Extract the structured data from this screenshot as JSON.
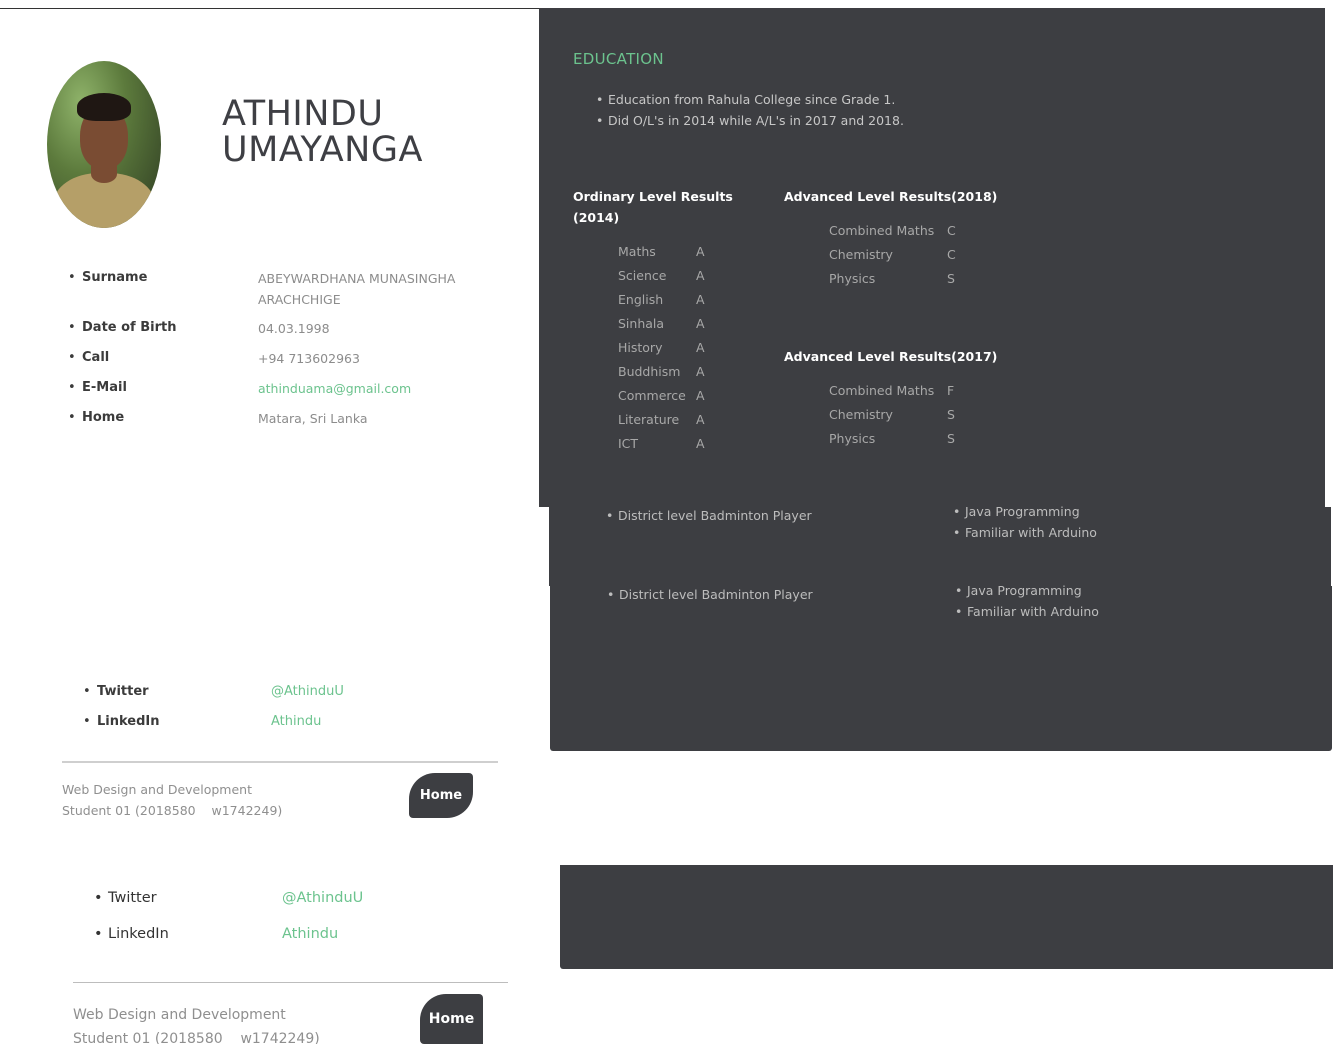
{
  "profile": {
    "first_name": "ATHINDU",
    "last_name": "UMAYANGA"
  },
  "info": [
    {
      "label": "Surname",
      "value_line1": "ABEYWARDHANA MUNASINGHA",
      "value_line2": "ARACHCHIGE"
    },
    {
      "label": "Date of Birth",
      "value": "04.03.1998"
    },
    {
      "label": "Call",
      "value": "+94 713602963"
    },
    {
      "label": "E-Mail",
      "value": "athinduama@gmail.com"
    },
    {
      "label": "Home",
      "value": "Matara, Sri Lanka"
    }
  ],
  "social": [
    {
      "label": "Twitter",
      "value": "@AthinduU"
    },
    {
      "label": "LinkedIn",
      "value": "Athindu"
    }
  ],
  "footer": {
    "line1": "Web Design and Development",
    "line2": "Student 01 (2018580    w1742249)",
    "home_label": "Home"
  },
  "education": {
    "title": "EDUCATION",
    "bullets": [
      "Education from Rahula College since Grade 1.",
      "Did O/L's in 2014 while A/L's in 2017 and 2018."
    ],
    "ol": {
      "title_line1": "Ordinary Level Results",
      "title_line2": "(2014)",
      "results": [
        {
          "subject": "Maths",
          "grade": "A"
        },
        {
          "subject": "Science",
          "grade": "A"
        },
        {
          "subject": "English",
          "grade": "A"
        },
        {
          "subject": "Sinhala",
          "grade": "A"
        },
        {
          "subject": "History",
          "grade": "A"
        },
        {
          "subject": "Buddhism",
          "grade": "A"
        },
        {
          "subject": "Commerce",
          "grade": "A"
        },
        {
          "subject": "Literature",
          "grade": "A"
        },
        {
          "subject": "ICT",
          "grade": "A"
        }
      ]
    },
    "al2018": {
      "title": "Advanced Level Results(2018)",
      "results": [
        {
          "subject": "Combined Maths",
          "grade": "C"
        },
        {
          "subject": "Chemistry",
          "grade": "C"
        },
        {
          "subject": "Physics",
          "grade": "S"
        }
      ]
    },
    "al2017": {
      "title": "Advanced Level Results(2017)",
      "results": [
        {
          "subject": "Combined Maths",
          "grade": "F"
        },
        {
          "subject": "Chemistry",
          "grade": "S"
        },
        {
          "subject": "Physics",
          "grade": "S"
        }
      ]
    }
  },
  "activities": {
    "sport": "District level Badminton Player",
    "skills": [
      "Java Programming",
      "Familiar with Arduino"
    ]
  },
  "colors": {
    "accent": "#6cc38e",
    "panel": "#3d3e42"
  }
}
